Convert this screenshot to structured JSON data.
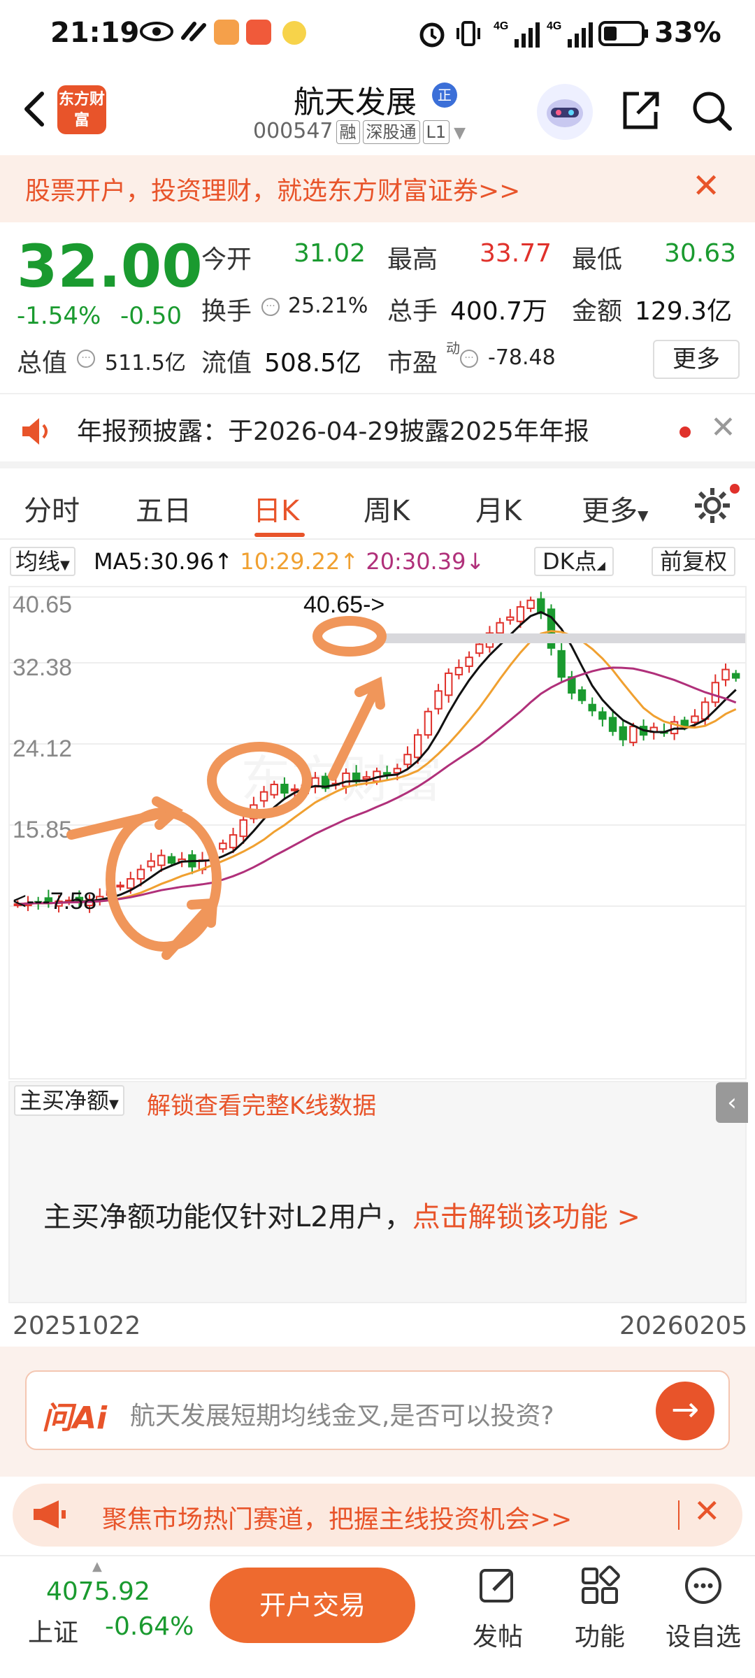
{
  "status_bar": {
    "time": "21:19",
    "battery": "33%"
  },
  "header": {
    "logo_text": "东方财富",
    "stock_name": "航天发展",
    "badge": "正",
    "code": "000547",
    "tags": [
      "融",
      "深股通",
      "L1"
    ]
  },
  "promo": {
    "text": "股票开户，投资理财，就选东方财富证券>>"
  },
  "quote": {
    "price": "32.00",
    "change_pct": "-1.54%",
    "change": "-0.50",
    "open_label": "今开",
    "open": "31.02",
    "high_label": "最高",
    "high": "33.77",
    "low_label": "最低",
    "low": "30.63",
    "turnover_label": "换手",
    "turnover": "25.21%",
    "volume_label": "总手",
    "volume": "400.7万",
    "amount_label": "金额",
    "amount": "129.3亿",
    "mktcap_label": "总值",
    "mktcap": "511.5亿",
    "float_label": "流值",
    "float": "508.5亿",
    "pe_label": "市盈",
    "pe_sup": "动",
    "pe": "-78.48",
    "more": "更多"
  },
  "notice": {
    "text": "年报预披露：于2026-04-29披露2025年年报"
  },
  "tabs": [
    "分时",
    "五日",
    "日K",
    "周K",
    "月K",
    "更多"
  ],
  "ma": {
    "selector": "均线",
    "ma5": "MA5:30.96↑",
    "ma10": "10:29.22↑",
    "ma20": "20:30.39↓",
    "dk": "DK点",
    "adjust": "前复权"
  },
  "chart_data": {
    "type": "candlestick",
    "y_ticks": [
      "40.65",
      "32.38",
      "24.12",
      "15.85"
    ],
    "max_label": "40.65->",
    "min_label": "<---7.58",
    "x_start": "20251022",
    "x_end": "20260205",
    "ylim": [
      7.58,
      40.65
    ],
    "watermark": "东方财富",
    "close": [
      7.8,
      7.9,
      8.0,
      7.9,
      8.1,
      8.2,
      8.1,
      8.3,
      8.6,
      9.2,
      9.8,
      10.5,
      11.5,
      12.4,
      13.0,
      12.2,
      12.6,
      11.8,
      12.5,
      13.4,
      14.3,
      15.2,
      16.8,
      18.4,
      19.8,
      20.6,
      19.7,
      20.1,
      20.5,
      21.3,
      20.2,
      20.7,
      21.8,
      20.9,
      21.4,
      22.0,
      21.7,
      22.3,
      23.8,
      25.9,
      28.4,
      30.6,
      32.5,
      33.1,
      34.2,
      35.6,
      36.8,
      37.9,
      38.5,
      39.6,
      40.3,
      38.9,
      35.2,
      32.1,
      30.4,
      29.6,
      28.5,
      27.6,
      26.3,
      25.4,
      26.8,
      25.9,
      26.7,
      26.2,
      27.3,
      26.8,
      27.9,
      29.4,
      31.5,
      32.9,
      32.0
    ],
    "colors": {
      "ma5": "#111111",
      "ma10": "#f0a030",
      "ma20": "#b0307a",
      "up": "#e0312b",
      "down": "#1a9a2f"
    }
  },
  "lower_panel": {
    "selector": "主买净额",
    "unlock_text": "解锁查看完整K线数据",
    "message": "主买净额功能仅针对L2用户，",
    "message_link": "点击解锁该功能 >"
  },
  "ai": {
    "logo": "问Ai",
    "question": "航天发展短期均线金叉,是否可以投资?"
  },
  "focus": {
    "text": "聚焦市场热门赛道，把握主线投资机会>>"
  },
  "bottom": {
    "index_value": "4075.92",
    "index_name": "上证",
    "index_change": "-0.64%",
    "trade": "开户交易",
    "nav": [
      "发帖",
      "功能",
      "设自选"
    ]
  }
}
